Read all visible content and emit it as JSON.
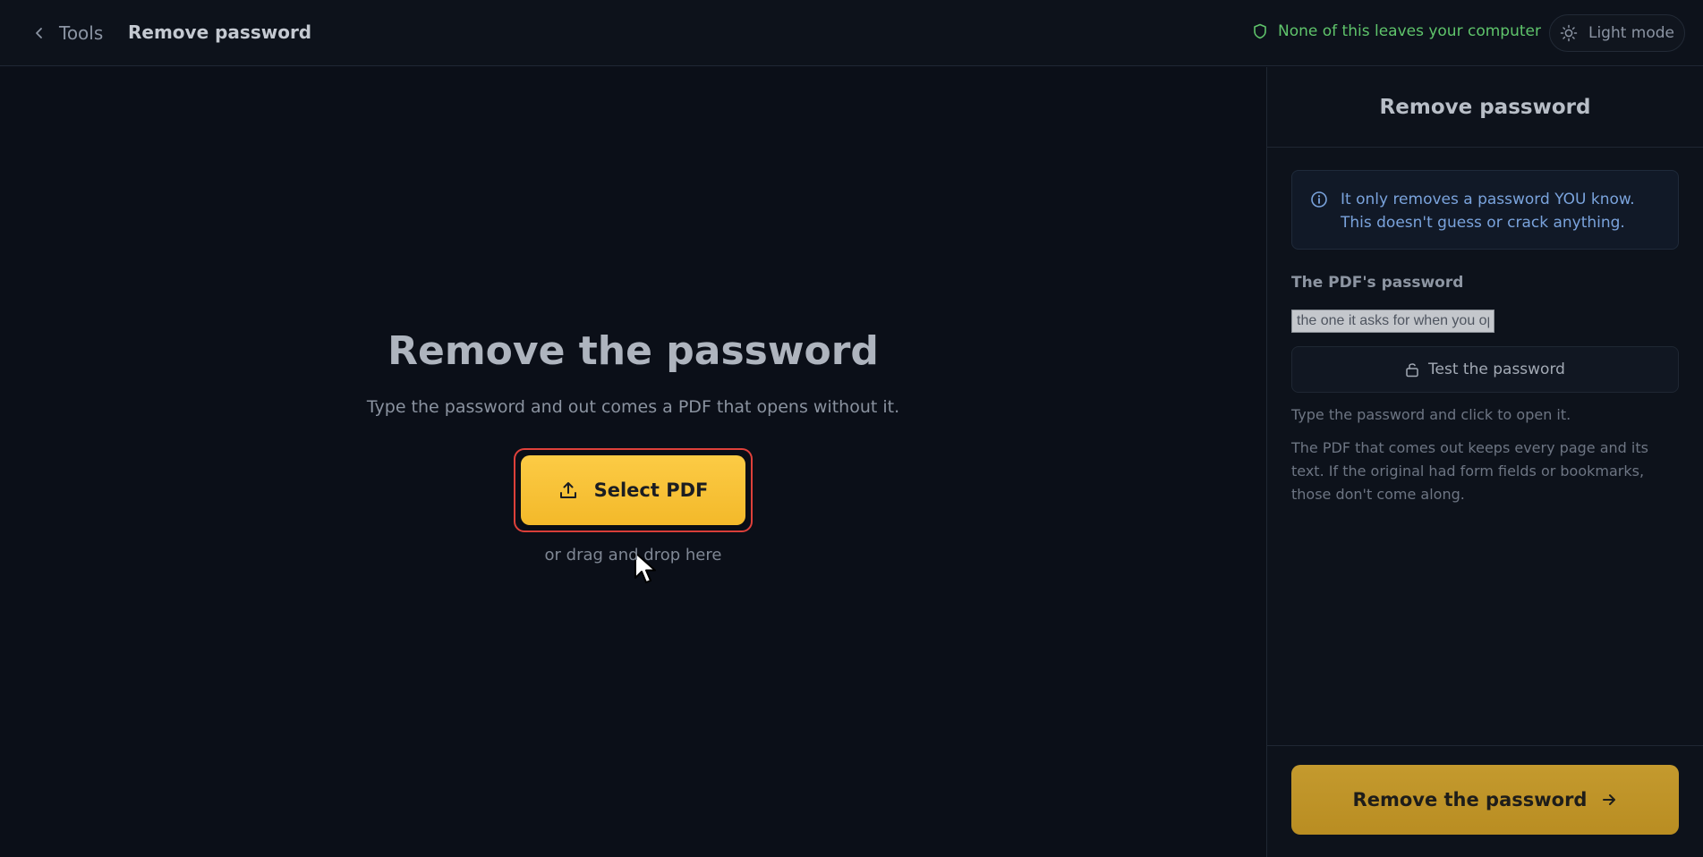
{
  "header": {
    "back_label": "Tools",
    "title": "Remove password",
    "privacy_text": "None of this leaves your computer",
    "mode_label": "Light mode"
  },
  "main": {
    "title": "Remove the password",
    "subtitle": "Type the password and out comes a PDF that opens without it.",
    "select_button": "Select PDF",
    "drag_hint": "or drag and drop here"
  },
  "sidebar": {
    "title": "Remove password",
    "info": "It only removes a password YOU know. This doesn't guess or crack anything.",
    "password_label": "The PDF's password",
    "password_placeholder": "the one it asks for when you open it",
    "password_value": "",
    "test_button": "Test the password",
    "hint_test": "Type the password and click to open it.",
    "hint_output": "The PDF that comes out keeps every page and its text. If the original had form fields or bookmarks, those don't come along.",
    "remove_button": "Remove the password"
  },
  "colors": {
    "accent": "#fccb45",
    "privacy_green": "#5fc46b",
    "info_blue": "#7aa3dc",
    "focus_red": "#e0413b"
  }
}
